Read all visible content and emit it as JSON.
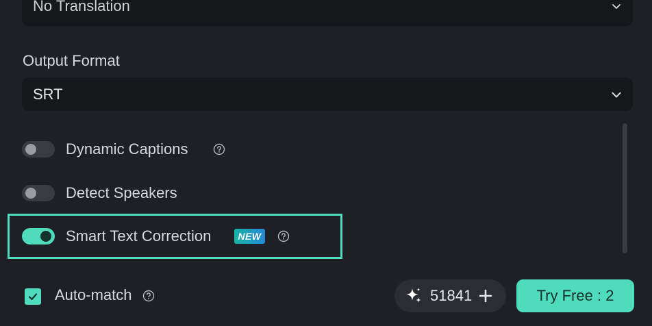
{
  "translation_select": {
    "value": "No Translation"
  },
  "output_format": {
    "label": "Output Format",
    "value": "SRT"
  },
  "options": [
    {
      "label": "Dynamic Captions",
      "enabled": false,
      "has_help": true
    },
    {
      "label": "Detect Speakers",
      "enabled": false,
      "has_help": false
    },
    {
      "label": "Smart Text Correction",
      "enabled": true,
      "badge": "NEW",
      "has_help": true
    }
  ],
  "auto_match": {
    "label": "Auto-match",
    "checked": true
  },
  "credits": {
    "count": "51841"
  },
  "try_button": {
    "label": "Try Free : 2"
  },
  "colors": {
    "accent": "#4fdcbd",
    "background": "#1e2025",
    "field": "#16171b"
  },
  "icons": {
    "dropdown": "chevron-down-icon",
    "help": "question-circle-icon",
    "credits": "sparkle-icon",
    "add": "plus-icon",
    "check": "checkmark-icon"
  }
}
